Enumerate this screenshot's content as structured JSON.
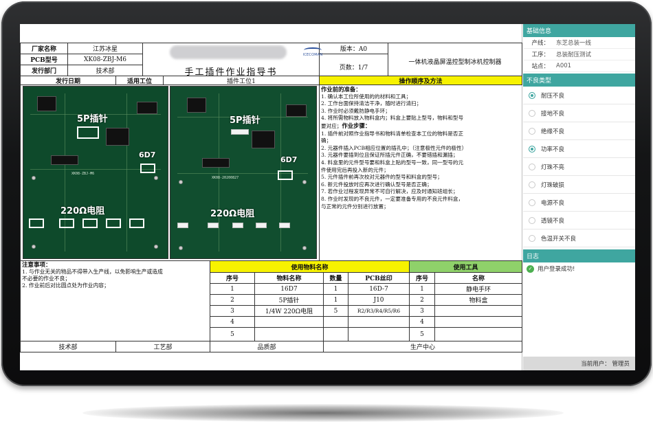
{
  "header": {
    "factory_label": "厂家名称",
    "factory_value": "江苏冰星",
    "pcb_label": "PCB型号",
    "pcb_value": "XK08-ZBJ-M6",
    "dept_label": "发行部门",
    "dept_value": "技术部",
    "date_label": "发行日期",
    "station_label": "适用工位",
    "station_value": "插件工位1",
    "version_label": "版本：A0",
    "pages_label": "页数：1/7",
    "product_name": "一体机液晶屏温控型制冰机控制器",
    "doc_title": "手工插件作业指导书",
    "logo_text": "ICECOMAN",
    "method_title": "操作顺序及方法"
  },
  "images": {
    "left": {
      "label_5p": "5P插针",
      "label_6d7": "6D7",
      "label_res": "220Ω电阻",
      "silk": "XK08-ZBJ-M6"
    },
    "right": {
      "label_5p": "5P插针",
      "label_6d7": "6D7",
      "label_res": "220Ω电阻",
      "silk": "XK08-20200827"
    }
  },
  "instructions": {
    "prep_head": "作业前的准备：",
    "prep": [
      "1. 确认本工位所使用的的材料和工具；",
      "2. 工作台面保持清洁干净，随时进行清扫；",
      "3. 作业时必须戴防静电手环；",
      "4. 将所需物料放入物料盒内；料盒上要贴上型号，物料和型号",
      "   要对应；"
    ],
    "steps_head": "作业步骤：",
    "steps": [
      "1. 插件前对照作业指导书和物料清单检查本工位的物料是否正",
      "   确；",
      "2. 元器件插入PCB相应位置的插孔中；（注意极性元件的极性）",
      "3. 元器件要插到位且保证所插元件正确，不要错插和漏插；",
      "4. 料盒里的元件型号要和料盒上贴的型号一致，同一型号的元",
      "   件使用完后再投入新的元件；",
      "5. 元件插件前再次校对元器件的型号和料盒的型号；",
      "6. 新元件投放时应再次进行确认型号是否正确；",
      "7. 若作业过程发现异常不可自行解决，应及时通知班组长；",
      "8. 作业时发现的不良元件，一定要准备专用的不良元件料盒，",
      "   与正常的元件分别进行放置；"
    ]
  },
  "notes": {
    "head": "注意事项：",
    "items": [
      "1. 与作业无关的物品不得带入生产线，以免影响生产或造成",
      "   不必要的作业不良；",
      "2. 作业前后对比圆点处为作业内容；"
    ]
  },
  "materials": {
    "title": "使用物料名称",
    "headers": [
      "序号",
      "物料名称",
      "数量",
      "PCB丝印"
    ],
    "rows": [
      [
        "1",
        "16D7",
        "1",
        "16D-7"
      ],
      [
        "2",
        "5P插针",
        "1",
        "J10"
      ],
      [
        "3",
        "1/4W 220Ω电阻",
        "5",
        "R2/R3/R4/R5/R6"
      ],
      [
        "4",
        "",
        "",
        ""
      ],
      [
        "5",
        "",
        "",
        ""
      ]
    ]
  },
  "tools": {
    "title": "使用工具",
    "headers": [
      "序号",
      "名称"
    ],
    "rows": [
      [
        "1",
        "静电手环"
      ],
      [
        "2",
        "物料盒"
      ],
      [
        "3",
        ""
      ],
      [
        "4",
        ""
      ],
      [
        "5",
        ""
      ]
    ]
  },
  "signatures": [
    "技术部",
    "工艺部",
    "品质部",
    "生产中心"
  ],
  "panel": {
    "basic_title": "基础信息",
    "line_label": "产线：",
    "line_value": "东芝总装一线",
    "process_label": "工序：",
    "process_value": "总装耐压测试",
    "station_label": "站点：",
    "station_value": "A001",
    "defect_title": "不良类型",
    "defects": [
      {
        "label": "耐压不良",
        "selected": true
      },
      {
        "label": "接地不良",
        "selected": false
      },
      {
        "label": "绝缘不良",
        "selected": false
      },
      {
        "label": "功率不良",
        "selected": true
      },
      {
        "label": "灯珠不亮",
        "selected": false
      },
      {
        "label": "灯珠破损",
        "selected": false
      },
      {
        "label": "电源不良",
        "selected": false
      },
      {
        "label": "透镜不良",
        "selected": false
      },
      {
        "label": "色温开关不良",
        "selected": false
      }
    ],
    "log_title": "日志",
    "log_entry": "用户登录成功!",
    "current_user": "当前用户：  管理员"
  },
  "colors": {
    "accent": "#3fa6a0",
    "yellow": "#f7f200",
    "green": "#8fd16a",
    "pcb": "#0e4a2b"
  }
}
